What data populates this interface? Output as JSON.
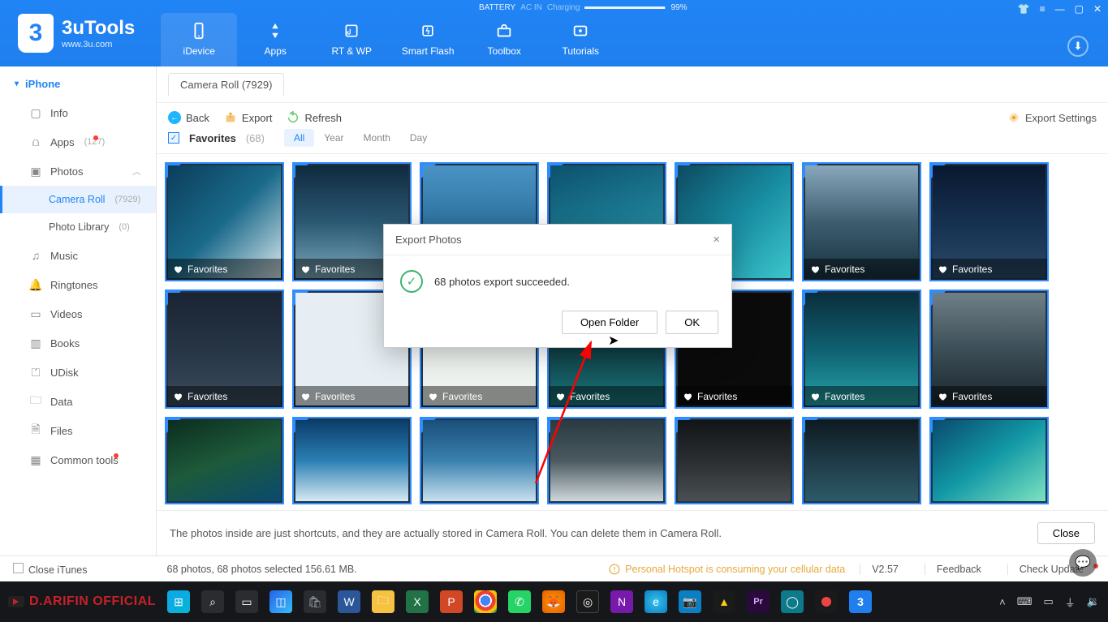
{
  "app": {
    "name": "3uTools",
    "url": "www.3u.com"
  },
  "battery": {
    "label": "BATTERY",
    "ac": "AC IN",
    "state": "Charging",
    "pct": "99%"
  },
  "nav": [
    {
      "id": "idevice",
      "label": "iDevice"
    },
    {
      "id": "apps",
      "label": "Apps"
    },
    {
      "id": "rtwp",
      "label": "RT & WP"
    },
    {
      "id": "smartflash",
      "label": "Smart Flash"
    },
    {
      "id": "toolbox",
      "label": "Toolbox"
    },
    {
      "id": "tutorials",
      "label": "Tutorials"
    }
  ],
  "sidebar": {
    "device": "iPhone",
    "items": [
      {
        "label": "Info"
      },
      {
        "label": "Apps",
        "count": "(127)",
        "dot": true
      },
      {
        "label": "Photos",
        "expandable": true
      },
      {
        "label": "Camera Roll",
        "count": "(7929)",
        "sub": true,
        "active": true
      },
      {
        "label": "Photo Library",
        "count": "(0)",
        "sub": true
      },
      {
        "label": "Music"
      },
      {
        "label": "Ringtones"
      },
      {
        "label": "Videos"
      },
      {
        "label": "Books"
      },
      {
        "label": "UDisk"
      },
      {
        "label": "Data"
      },
      {
        "label": "Files"
      },
      {
        "label": "Common tools",
        "dot": true
      }
    ]
  },
  "content": {
    "tab": "Camera Roll (7929)",
    "toolbar": {
      "back": "Back",
      "export": "Export",
      "refresh": "Refresh",
      "settings": "Export Settings"
    },
    "filter": {
      "favorites": "Favorites",
      "count": "(68)",
      "seg": [
        "All",
        "Year",
        "Month",
        "Day"
      ]
    },
    "thumb_label": "Favorites",
    "notice": "The photos inside are just shortcuts, and they are actually stored in Camera Roll. You can delete them in Camera Roll.",
    "close": "Close"
  },
  "modal": {
    "title": "Export Photos",
    "message": "68 photos export succeeded.",
    "open": "Open Folder",
    "ok": "OK"
  },
  "status": {
    "close_itunes": "Close iTunes",
    "summary": "68 photos, 68 photos selected 156.61 MB.",
    "hotspot": "Personal Hotspot is consuming your cellular data",
    "version": "V2.57",
    "feedback": "Feedback",
    "update": "Check Update"
  },
  "taskbar": {
    "brand": "D.ARIFIN OFFICIAL"
  }
}
